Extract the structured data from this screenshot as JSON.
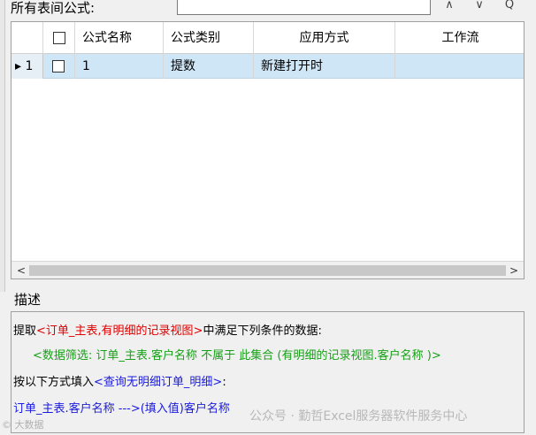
{
  "toolbar": {
    "title": "所有表间公式:",
    "search_value": "",
    "up_glyph": "∧",
    "down_glyph": "∨",
    "search_glyph": "Q"
  },
  "grid": {
    "columns": [
      "",
      "",
      "公式名称",
      "公式类别",
      "应用方式",
      "工作流"
    ],
    "rows": [
      {
        "indicator": "▸",
        "num": "1",
        "checked": false,
        "name": "1",
        "category": "提数",
        "apply": "新建打开时",
        "workflow": ""
      }
    ],
    "scroll_left": "<",
    "scroll_right": ">"
  },
  "description": {
    "label": "描述",
    "line1": {
      "a": "提取",
      "b": "<订单_主表,有明细的记录视图>",
      "c": "中满足下列条件的数据:"
    },
    "line2": {
      "a": "<数据筛选: 订单_主表.客户名称  不属于  此集合 (有明细的记录视图.客户名称 )>"
    },
    "line3": {
      "a": "按以下方式填入",
      "b": "<查询无明细订单_明细>",
      "c": ":"
    },
    "line4": {
      "a": "订单_主表.客户名称  --->(填入值)客户名称"
    }
  },
  "watermarks": {
    "right": "公众号 · 勤哲Excel服务器软件服务中心",
    "left": "© 大数据"
  }
}
